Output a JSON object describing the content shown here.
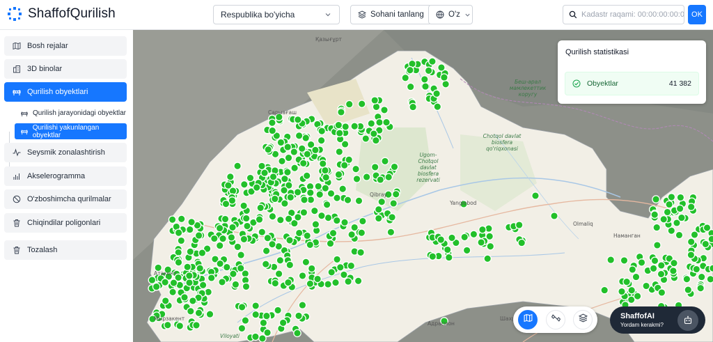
{
  "app": {
    "title": "ShaffofQurilish"
  },
  "header": {
    "region_select": "Respublika bo'yicha",
    "field_button": "Sohani tanlang",
    "language": "O'z",
    "search_placeholder": "Kadastr raqami: 00:00:00:00:0",
    "ok_label": "OK"
  },
  "sidebar": {
    "items": [
      {
        "label": "Bosh rejalar",
        "icon": "map-icon"
      },
      {
        "label": "3D binolar",
        "icon": "buildings-icon"
      },
      {
        "label": "Qurilish obyektlari",
        "icon": "barrier-icon",
        "active": true
      },
      {
        "label": "Seysmik zonalashtirish",
        "icon": "seismic-icon"
      },
      {
        "label": "Akselerogramma",
        "icon": "bar-chart-icon"
      },
      {
        "label": "O'zboshimcha qurilmalar",
        "icon": "ban-icon"
      },
      {
        "label": "Chiqindilar poligonlari",
        "icon": "trash-icon"
      },
      {
        "label": "Tozalash",
        "icon": "trash-icon"
      }
    ],
    "sub_items": [
      {
        "label": "Qurilish jarayonidagi obyektlar",
        "icon": "barrier-icon"
      },
      {
        "label": "Qurilishi yakunlangan obyektlar",
        "icon": "barrier-icon",
        "active": true
      }
    ]
  },
  "stats": {
    "title": "Qurilish statistikasi",
    "row_label": "Obyektlar",
    "row_value": "41 382"
  },
  "map": {
    "labels": [
      "Қазығұрт",
      "Сарыағаш",
      "Беш-арал мамлекеттик коругу",
      "Ugom-Chotqol davlat biosfera rezervati",
      "Chotqol davlat biosfera qo'riqxonasi",
      "Qibray",
      "Yangiobod",
      "Olmaliq",
      "Наманган",
      "Атакент",
      "Мырзакент",
      "Viloyati",
      "Адрасмон",
      "Шахристон"
    ],
    "land_color": "#f2efe6",
    "marker_color": "#22c02a"
  },
  "controls": {
    "buttons": [
      "map-view-icon",
      "satellite-icon",
      "layers-icon"
    ]
  },
  "ai": {
    "title": "ShaffofAI",
    "subtitle": "Yordam kerakmi?"
  }
}
